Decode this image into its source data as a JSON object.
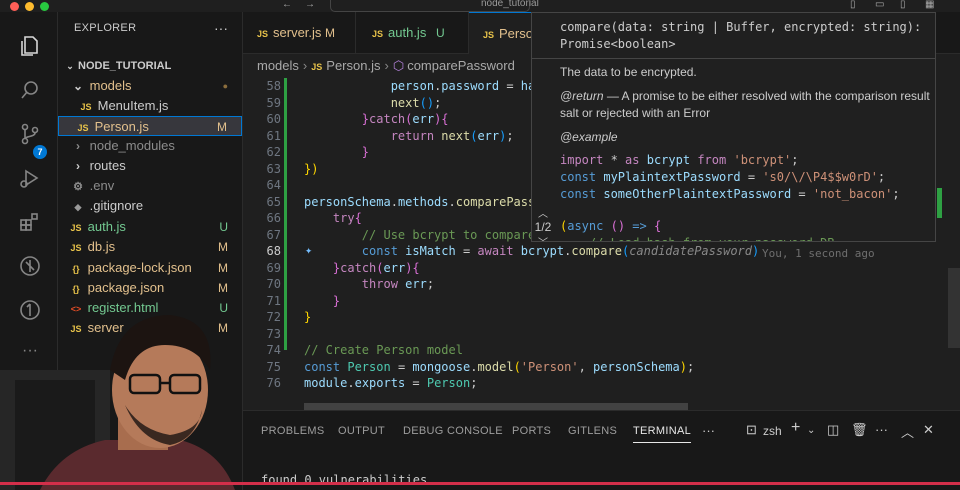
{
  "title_bar": {
    "search_text": "node_tutorial"
  },
  "activity_bar": {
    "scm_badge": "7"
  },
  "sidebar": {
    "header": "EXPLORER",
    "more": "···",
    "project": "NODE_TUTORIAL",
    "items": [
      {
        "label": "models",
        "status": "●"
      },
      {
        "label": "MenuItem.js",
        "icon": "JS",
        "status": ""
      },
      {
        "label": "Person.js",
        "icon": "JS",
        "status": "M"
      },
      {
        "label": "node_modules",
        "status": ""
      },
      {
        "label": "routes",
        "status": ""
      },
      {
        "label": ".env",
        "status": ""
      },
      {
        "label": ".gitignore",
        "status": ""
      },
      {
        "label": "auth.js",
        "icon": "JS",
        "status": "U"
      },
      {
        "label": "db.js",
        "icon": "JS",
        "status": "M"
      },
      {
        "label": "package-lock.json",
        "icon": "{}",
        "status": "M"
      },
      {
        "label": "package.json",
        "icon": "{}",
        "status": "M"
      },
      {
        "label": "register.html",
        "icon": "<>",
        "status": "U"
      },
      {
        "label": "server",
        "icon": "JS",
        "status": "M"
      }
    ]
  },
  "tabs": [
    {
      "icon": "JS",
      "label": "server.js",
      "status": "M"
    },
    {
      "icon": "JS",
      "label": "auth.js",
      "status": "U"
    },
    {
      "icon": "JS",
      "label": "Perso",
      "status": ""
    }
  ],
  "breadcrumb": {
    "folder": "models",
    "file_icon": "JS",
    "file": "Person.js",
    "symbol": "comparePassword"
  },
  "editor": {
    "line_numbers": [
      "58",
      "59",
      "60",
      "61",
      "62",
      "63",
      "64",
      "65",
      "66",
      "67",
      "68",
      "69",
      "70",
      "71",
      "72",
      "73",
      "74",
      "75",
      "76"
    ],
    "blame": "You, 1 second ago"
  },
  "hover": {
    "signature_1": "compare(data: string | Buffer, encrypted: string):",
    "signature_2": "Promise<boolean>",
    "param_doc": "The data to be encrypted.",
    "return_tag": "@return",
    "return_doc": " — A promise to be either resolved with the comparison result salt or rejected with an Error",
    "example_tag": "@example",
    "overload": "1/2"
  },
  "panel": {
    "tabs": [
      "PROBLEMS",
      "OUTPUT",
      "DEBUG CONSOLE",
      "PORTS",
      "GITLENS",
      "TERMINAL"
    ],
    "more": "···",
    "shell": "zsh",
    "terminal_line": "found 0 vulnerabilities"
  }
}
